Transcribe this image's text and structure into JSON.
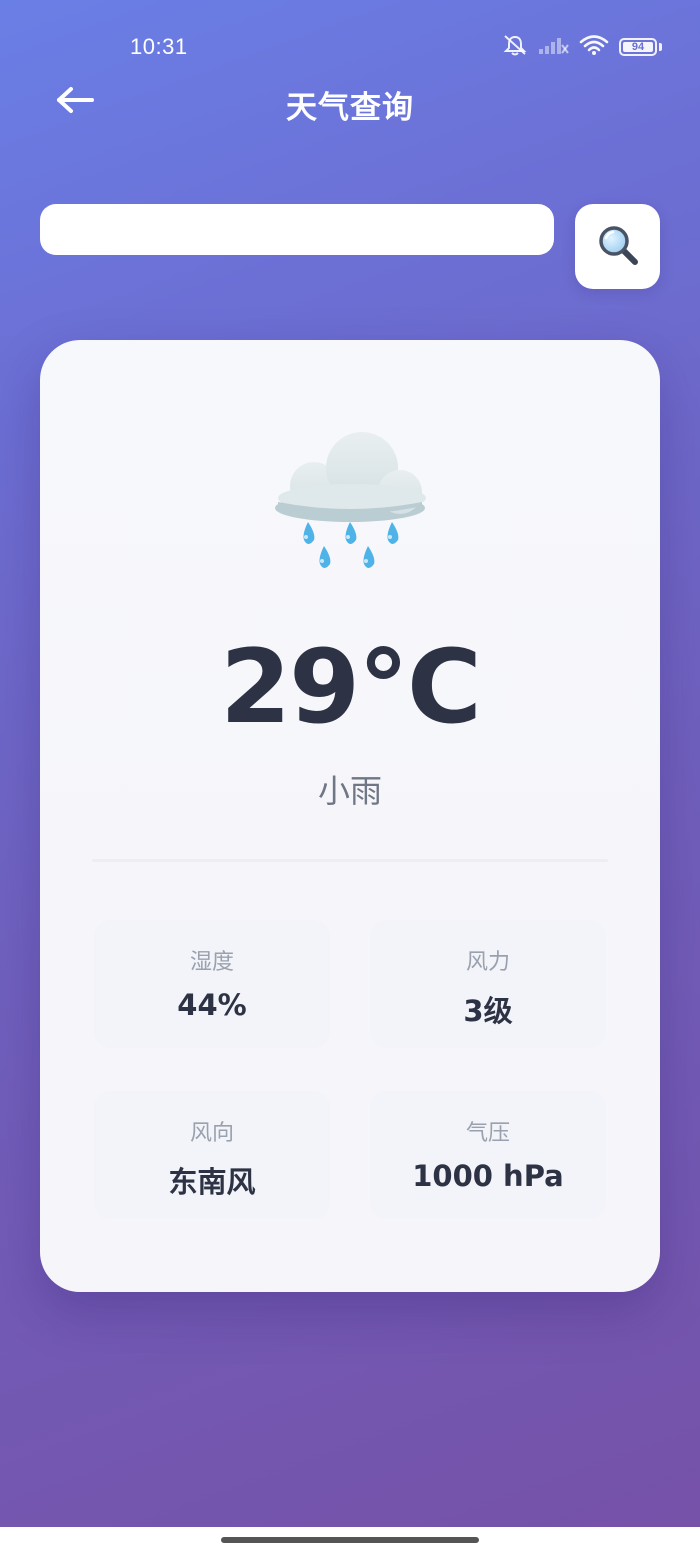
{
  "status_bar": {
    "time": "10:31",
    "battery_level": "94"
  },
  "header": {
    "title": "天气查询",
    "back_icon": "arrow-left-icon"
  },
  "search": {
    "value": "",
    "placeholder": "",
    "button_icon": "magnifier-icon"
  },
  "weather": {
    "icon": "cloud-rain-icon",
    "temperature": "29°C",
    "condition": "小雨",
    "stats": [
      {
        "label": "湿度",
        "value": "44%"
      },
      {
        "label": "风力",
        "value": "3级"
      },
      {
        "label": "风向",
        "value": "东南风"
      },
      {
        "label": "气压",
        "value": "1000 hPa"
      }
    ]
  },
  "colors": {
    "gradient_start": "#6a7fe6",
    "gradient_end": "#7651a8",
    "card_background": "#f7f8fb",
    "text_primary": "#2d3345",
    "text_secondary": "#9aa1ae",
    "rain_drop": "#4fb3e8"
  }
}
